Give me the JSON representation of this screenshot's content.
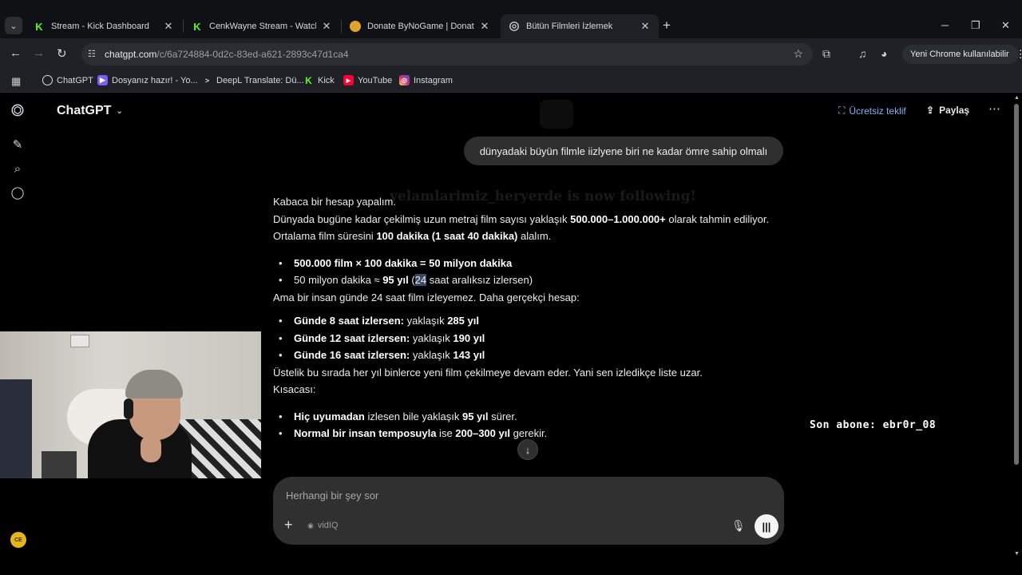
{
  "browser": {
    "tabs": [
      {
        "title": "Stream - Kick Dashboard",
        "icon": "kick-icon"
      },
      {
        "title": "CenkWayne Stream - Watch Live",
        "icon": "kick-icon"
      },
      {
        "title": "Donate ByNoGame | Donations",
        "icon": "bynogame-icon"
      },
      {
        "title": "Bütün Filmleri İzlemek",
        "icon": "chatgpt-icon",
        "active": true
      }
    ],
    "url_host": "chatgpt.com",
    "url_path": "/c/6a724884-0d2c-83ed-a621-2893c47d1ca4",
    "profile_label": "Yeni Chrome kullanılabilir",
    "bookmarks": [
      {
        "label": "ChatGPT",
        "icon": "chatgpt-icon",
        "color": "#ffffff"
      },
      {
        "label": "Dosyanız hazır! - Yo...",
        "icon": "file-icon",
        "color": "#7b5cff"
      },
      {
        "label": "DeepL Translate: Dü...",
        "icon": "deepl-icon",
        "color": "#0f2b46"
      },
      {
        "label": "Kick",
        "icon": "kick-icon",
        "color": "#53fc18"
      },
      {
        "label": "YouTube",
        "icon": "youtube-icon",
        "color": "#ff0033"
      },
      {
        "label": "Instagram",
        "icon": "instagram-icon",
        "color": "#d62976"
      }
    ]
  },
  "chatgpt": {
    "model_title": "ChatGPT",
    "free_offer": "Ücretsiz teklif",
    "share": "Paylaş",
    "avatar_initials": "CE",
    "user_message": "dünyadaki büyün filmle iizlyene biri ne kadar ömre sahip olmalı",
    "answer": {
      "intro": "Kabaca bir hesap yapalım.",
      "p1_pre": "Dünyada bugüne kadar çekilmiş uzun metraj film sayısı yaklaşık ",
      "p1_bold": "500.000–1.000.000+",
      "p1_post": " olarak tahmin ediliyor.",
      "p2_pre": "Ortalama film süresini ",
      "p2_bold": "100 dakika (1 saat 40 dakika)",
      "p2_post": " alalım.",
      "b1": "500.000 film × 100 dakika = 50 milyon dakika",
      "b2_pre": "50 milyon dakika ≈ ",
      "b2_bold": "95 yıl",
      "b2_paren": " (",
      "b2_hl": "24",
      "b2_post": " saat aralıksız izlersen)",
      "p3": "Ama bir insan günde 24 saat film izleyemez. Daha gerçekçi hesap:",
      "c1_bold": "Günde 8 saat izlersen:",
      "c1_rest": " yaklaşık ",
      "c1_val": "285 yıl",
      "c2_bold": "Günde 12 saat izlersen:",
      "c2_rest": " yaklaşık ",
      "c2_val": "190 yıl",
      "c3_bold": "Günde 16 saat izlersen:",
      "c3_rest": " yaklaşık ",
      "c3_val": "143 yıl",
      "p4": "Üstelik bu sırada her yıl binlerce yeni film çekilmeye devam eder. Yani sen izledikçe liste uzar.",
      "summary": "Kısacası:",
      "s1_bold": "Hiç uyumadan",
      "s1_mid": " izlesen bile yaklaşık ",
      "s1_val": "95 yıl",
      "s1_post": " sürer.",
      "s2_bold": "Normal bir insan temposuyla",
      "s2_mid": " ise ",
      "s2_val": "200–300 yıl",
      "s2_post": " gerekir."
    },
    "composer_placeholder": "Herhangi bir şey sor",
    "vidiq_label": "vidIQ"
  },
  "stream_overlay": {
    "follow_alert": "yelamlarimiz_heryerde is now following!",
    "last_sub": "Son abone: ebr0r_08"
  }
}
